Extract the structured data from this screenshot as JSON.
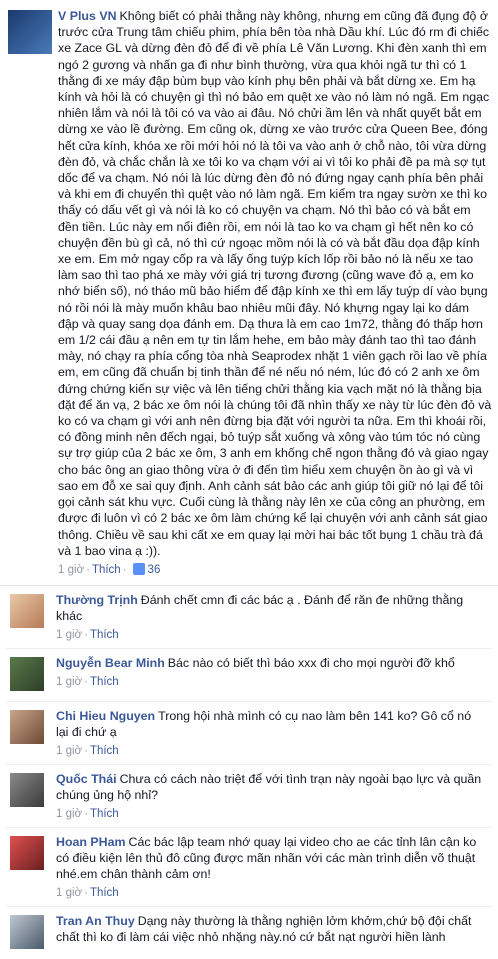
{
  "post": {
    "author": "V Plus VN",
    "text": "Không biết có phải thằng này không, nhưng em cũng đã đụng độ ở trước cửa Trung tâm chiếu phim, phía bên tòa nhà Dầu khí. Lúc đó rm đi chiếc xe Zace GL và dừng đèn đỏ để đi về phía Lê Văn Lương. Khi đèn xanh thì em ngó 2 gương và nhấn ga đi như bình thường, vừa qua khỏi ngã tư thì có 1 thằng đi xe máy đập bùm bụp vào kính phụ bên phải và bắt dừng xe. Em hạ kính và hỏi là có chuyện gì thì nó bảo em quệt xe vào nó làm nó ngã. Em ngạc nhiên lắm và nói là tôi có va vào ai đâu. Nó chửi ầm lên và nhất quyết bắt em dừng xe vào lề đường. Em cũng ok, dừng xe vào trước cửa Queen Bee, đóng hết cửa kính, khóa xe rồi mới hỏi nó là tôi va vào anh ở chỗ nào, tôi vừa dừng đèn đỏ, và chắc chắn là xe tôi ko va chạm với ai vì tôi ko phải đề pa mà sợ tụt dốc để va chạm. Nó nói là lúc dừng đèn đỏ nó đứng ngay cạnh phía bên phải và khi em đi chuyển thì quệt vào nó làm ngã. Em kiểm tra ngay sườn xe thì ko thấy có dấu vết gì và nói là ko có chuyện va chạm. Nó thì bảo có và bắt em đền tiền. Lúc này em nổi điên rồi, em nói là tao ko va chạm gì hết nên ko có chuyện đền bù gì cả, nó thì cứ ngoạc mồm nói là có và bắt đầu dọa đập kính xe em. Em mở ngay cốp ra và lấy ống tuýp kích lốp rồi bảo nó là nếu xe tao làm sao thì tao phá xe mày với giá trị tương đương (cũng wave đỏ ạ, em ko nhớ biển số), nó tháo mũ bảo hiểm để đập kính xe thì em lấy tuýp dí vào bụng nó rồi nói là mày muốn khâu bao nhiêu mũi đây. Nó khựng ngay lại ko dám đập và quay sang dọa đánh em. Dạ thưa là em cao 1m72, thằng đó thấp hơn em 1/2 cái đầu ạ nên em tự tin lắm hehe, em bảo mày đánh tao thì tao đánh mày, nó chạy ra phía cổng tòa nhà Seaprodex nhặt 1 viên gạch rồi lao về phía em, em cũng đã chuẩn bị tinh thần để né nếu nó ném, lúc đó có 2 anh xe ôm đứng chứng kiến sự việc và lên tiếng chửi thằng kia vạch mặt nó là thằng bịa đặt để ăn vạ, 2 bác xe ôm nói là chúng tôi đã nhìn thấy xe này từ lúc đèn đỏ và ko có va chạm gì với anh nên đừng bịa đặt với người ta nữa. Em thì khoái rồi, có đồng minh nên đếch ngại, bỏ tuýp sắt xuống và xông vào túm tóc nó cùng sự trợ giúp của 2 bác xe ôm, 3 anh em khống chế ngon thằng đó và giao ngay cho bác ông an giao thông vừa ở đi đến tìm hiểu xem chuyện ồn ào gì và vì sao em đỗ xe sai quy định. Anh cảnh sát bảo các anh giúp tôi giữ nó lại để tôi gọi cảnh sát khu vực. Cuối cùng là thằng này lên xe của công an phường, em được đi luôn vì có 2 bác xe ôm làm chứng kể lại chuyện với anh cảnh sát giao thông. Chiều về sau khi cất xe em quay lại mời hai bác tốt bụng 1 chầu trà đá và 1 bao vina ạ :)).",
    "time": "1 giờ",
    "action": "Thích",
    "likes": "36",
    "like_color": "#5890ff"
  },
  "comments": [
    {
      "name": "Thường Trịnh",
      "text": "Đánh chết cmn đi các bác ạ . Đánh để răn đe những thằng khác",
      "time": "1 giờ",
      "action": "Thích"
    },
    {
      "name": "Nguyễn Bear Minh",
      "text": "Bác nào có biết thì báo xxx đi cho mọi người đỡ khổ",
      "time": "1 giờ",
      "action": "Thích"
    },
    {
      "name": "Chi Hieu Nguyen",
      "text": "Trong hội nhà mình có cụ nao làm bên 141 ko? Gô cổ nó lại đi chứ ạ",
      "time": "1 giờ",
      "action": "Thích"
    },
    {
      "name": "Quốc Thái",
      "text": "Chưa có cách nào triệt để với tình trạn này ngoài bạo lực và quần chúng ủng hộ nhỉ?",
      "time": "1 giờ",
      "action": "Thích"
    },
    {
      "name": "Hoan PHam",
      "text": "Các bác lập team nhớ quay lại video cho ae các tỉnh lân cận ko có điều kiện lên thủ đô cũng được mãn nhãn với các màn trình diễn võ thuật nhé.em chân thành cảm ơn!",
      "time": "1 giờ",
      "action": "Thích"
    },
    {
      "name": "Tran An Thuy",
      "text": "Dạng này thường là thằng nghiện lởm khởm,chứ bộ đội chất chất thì ko đi làm cái việc nhỏ nhặng này.nó cứ bắt nạt người hiền lành",
      "time": "",
      "action": ""
    }
  ]
}
